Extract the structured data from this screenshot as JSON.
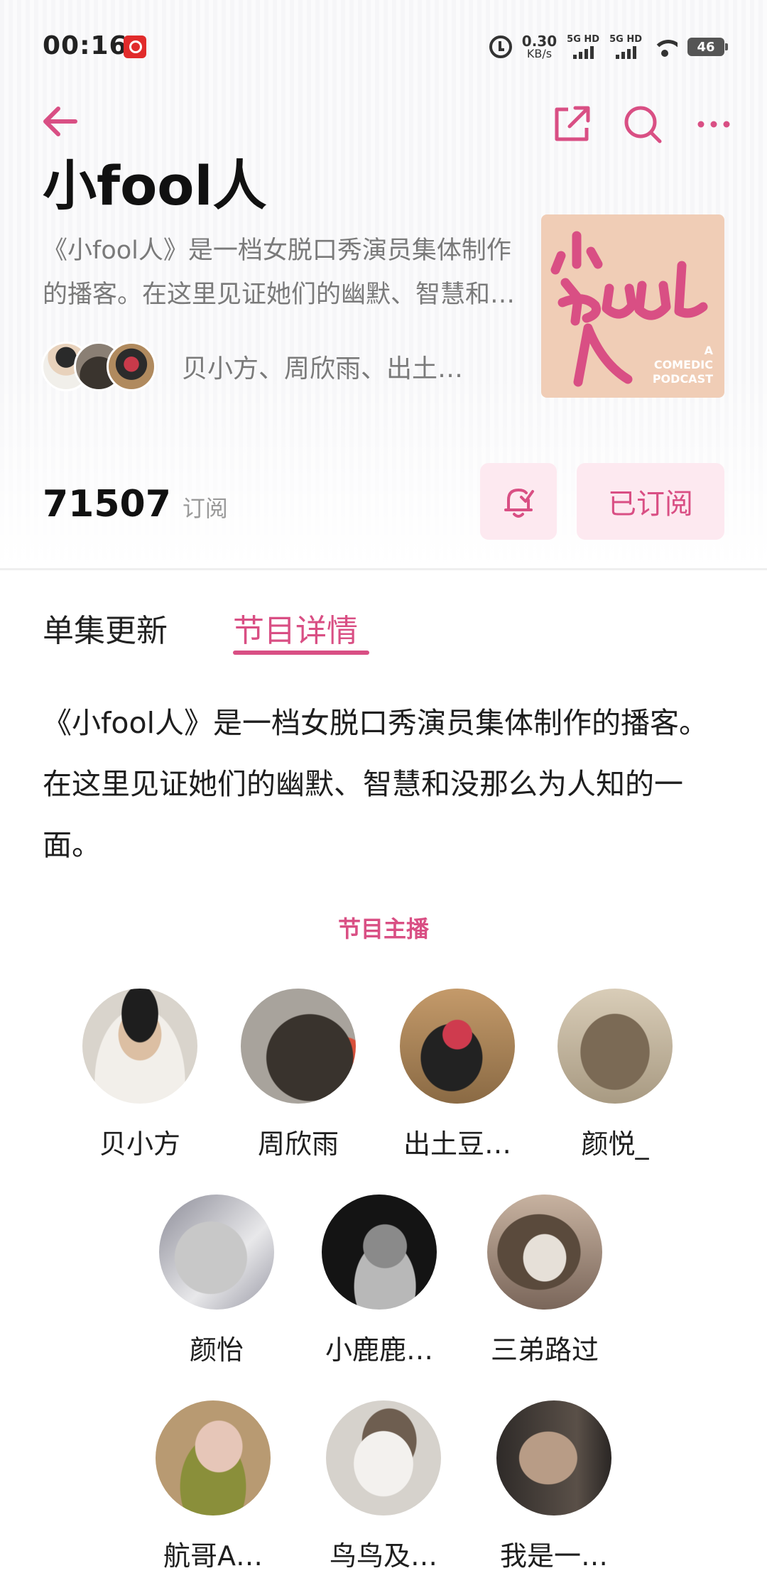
{
  "status_bar": {
    "time": "00:16",
    "net_speed": "0.30",
    "net_unit": "KB/s",
    "sim1": "5G HD",
    "sim2": "5G HD",
    "battery": "46"
  },
  "podcast": {
    "title": "小fool人",
    "short_desc": "《小fool人》是一档女脱口秀演员集体制作的播客。在这里见证她们的幽默、智慧和没那么为人知的一面。",
    "host_summary": "贝小方、周欣雨、出土…",
    "cover_text": "A COMEDIC PODCAST",
    "accent_color": "#d94f84",
    "cover_color": "#f0cdb6"
  },
  "subscription": {
    "count": "71507",
    "count_label": "订阅",
    "subscribed_label": "已订阅"
  },
  "tabs": [
    {
      "label": "单集更新"
    },
    {
      "label": "节目详情"
    }
  ],
  "details": {
    "description": "《小fool人》是一档女脱口秀演员集体制作的播客。在这里见证她们的幽默、智慧和没那么为人知的一面。",
    "hosts_title": "节目主播",
    "hosts": [
      {
        "name": "贝小方"
      },
      {
        "name": "周欣雨"
      },
      {
        "name": "出土豆…"
      },
      {
        "name": "颜悦_"
      },
      {
        "name": "颜怡"
      },
      {
        "name": "小鹿鹿…"
      },
      {
        "name": "三弟路过"
      },
      {
        "name": "航哥A…"
      },
      {
        "name": "鸟鸟及…"
      },
      {
        "name": "我是一…"
      }
    ]
  }
}
